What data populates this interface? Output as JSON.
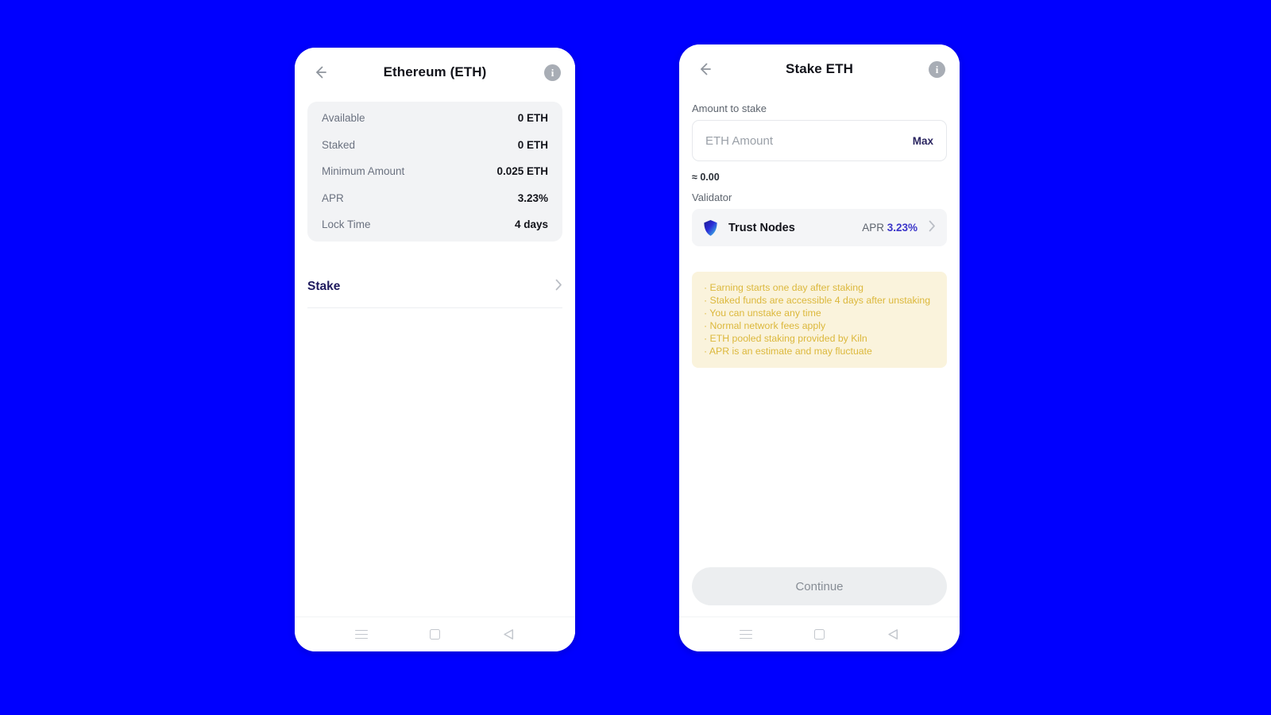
{
  "background_color": "#0000ff",
  "left_phone": {
    "header": {
      "back_icon": "arrow-left-icon",
      "title": "Ethereum (ETH)",
      "info_icon": "info-icon",
      "info_glyph": "i"
    },
    "info_card": {
      "rows": [
        {
          "label": "Available",
          "value": "0 ETH"
        },
        {
          "label": "Staked",
          "value": "0 ETH"
        },
        {
          "label": "Minimum Amount",
          "value": "0.025 ETH"
        },
        {
          "label": "APR",
          "value": "3.23%"
        },
        {
          "label": "Lock Time",
          "value": "4 days"
        }
      ]
    },
    "stake_row": {
      "label": "Stake",
      "chevron": "chevron-right-icon",
      "chevron_glyph": "›"
    }
  },
  "right_phone": {
    "header": {
      "back_icon": "arrow-left-icon",
      "title": "Stake ETH",
      "info_icon": "info-icon",
      "info_glyph": "i"
    },
    "amount_section": {
      "label": "Amount to stake",
      "placeholder": "ETH Amount",
      "value": "",
      "max_label": "Max",
      "approx_value": "≈ 0.00"
    },
    "validator_section": {
      "label": "Validator",
      "icon": "shield-icon",
      "name": "Trust Nodes",
      "apr_label": "APR",
      "apr_value": "3.23%",
      "apr_color": "#3b35c9",
      "chevron": "chevron-right-icon",
      "chevron_glyph": "›"
    },
    "notice": {
      "background_color": "#faf3dc",
      "text_color": "#dcb83c",
      "lines": [
        "· Earning starts one day after staking",
        "· Staked funds are accessible 4 days after unstaking",
        "· You can unstake any time",
        "· Normal network fees apply",
        "· ETH pooled staking provided by Kiln",
        "· APR is an estimate and may fluctuate"
      ]
    },
    "continue_button": {
      "label": "Continue",
      "enabled": false
    }
  },
  "navbar": {
    "menu_icon": "menu-icon",
    "home_icon": "home-square-icon",
    "back_icon": "back-triangle-icon"
  }
}
